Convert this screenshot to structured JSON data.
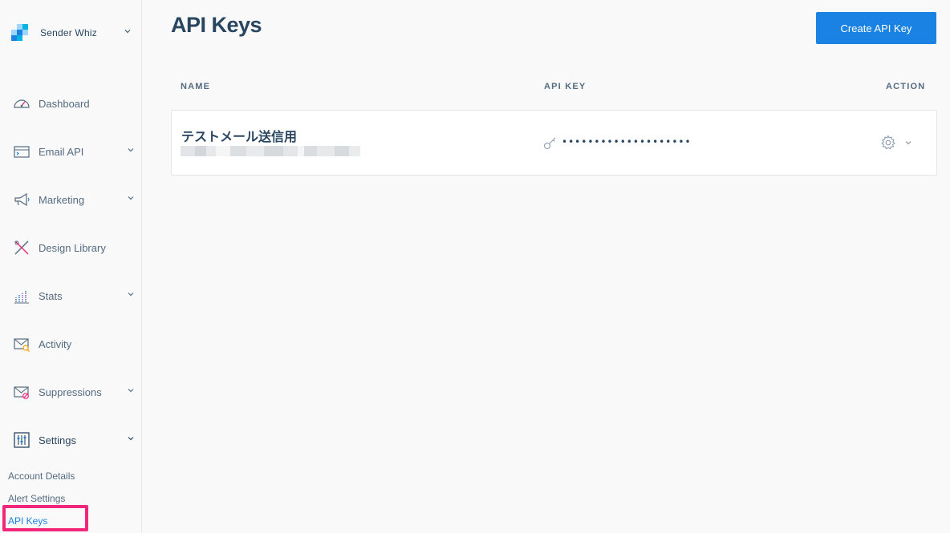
{
  "sidebar": {
    "account_name": "Sender Whiz",
    "items": [
      {
        "label": "Dashboard",
        "icon": "dashboard-gauge-icon",
        "has_chevron": false
      },
      {
        "label": "Email API",
        "icon": "email-api-icon",
        "has_chevron": true
      },
      {
        "label": "Marketing",
        "icon": "megaphone-icon",
        "has_chevron": true
      },
      {
        "label": "Design Library",
        "icon": "design-library-icon",
        "has_chevron": false
      },
      {
        "label": "Stats",
        "icon": "stats-icon",
        "has_chevron": true
      },
      {
        "label": "Activity",
        "icon": "activity-envelope-icon",
        "has_chevron": false
      },
      {
        "label": "Suppressions",
        "icon": "suppressions-envelope-icon",
        "has_chevron": true
      },
      {
        "label": "Settings",
        "icon": "settings-sliders-icon",
        "has_chevron": true,
        "expanded": true
      }
    ],
    "settings_sub": [
      {
        "label": "Account Details",
        "active": false
      },
      {
        "label": "Alert Settings",
        "active": false
      },
      {
        "label": "API Keys",
        "active": true
      }
    ]
  },
  "page": {
    "title": "API Keys",
    "create_button": "Create API Key"
  },
  "table": {
    "headers": {
      "name": "NAME",
      "api_key": "API KEY",
      "action": "ACTION"
    },
    "rows": [
      {
        "name": "テストメール送信用",
        "masked_key": "••••••••••••••••••••"
      }
    ]
  },
  "colors": {
    "brand_blue": "#1a82e2",
    "text_dark": "#294661",
    "text_muted": "#546b81",
    "highlight": "#f0277b"
  }
}
